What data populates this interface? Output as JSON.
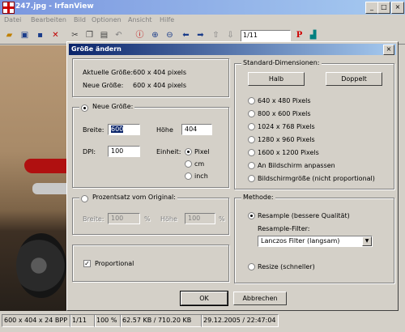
{
  "window": {
    "title": "247.jpg - IrfanView",
    "minimize": "_",
    "maximize": "□",
    "close": "×"
  },
  "menu": [
    "Datei",
    "Bearbeiten",
    "Bild",
    "Optionen",
    "Ansicht",
    "Hilfe"
  ],
  "toolbar": {
    "icons": [
      "open-folder-icon",
      "slideshow-icon",
      "save-icon",
      "delete-icon",
      "cut-icon",
      "copy-icon",
      "paste-icon",
      "undo-icon",
      "info-icon",
      "zoom-in-icon",
      "zoom-out-icon",
      "prev-arrow-icon",
      "next-arrow-icon",
      "first-page-icon",
      "last-page-icon"
    ],
    "page_box": "1/11",
    "print_letter": "P"
  },
  "dialog": {
    "title": "Größe ändern",
    "close": "×",
    "current_size_label": "Aktuelle Größe:",
    "current_size_value": "600  x  404  pixels",
    "new_size_label": "Neue Größe:",
    "new_size_value": "600  x  404  pixels",
    "new_size_group": "Neue Größe:",
    "width_label": "Breite:",
    "width_value": "600",
    "height_label": "Höhe",
    "height_value": "404",
    "dpi_label": "DPI:",
    "dpi_value": "100",
    "unit_label": "Einheit:",
    "unit_options": [
      "Pixel",
      "cm",
      "inch"
    ],
    "unit_selected": "Pixel",
    "percent_group": "Prozentsatz vom Original:",
    "pct_width_label": "Breite:",
    "pct_width_value": "100",
    "pct_height_label": "Höhe",
    "pct_height_value": "100",
    "percent_sign": "%",
    "proportional_label": "Proportional",
    "proportional_checked": true,
    "standard_group": "Standard-Dimensionen:",
    "half_button": "Halb",
    "double_button": "Doppelt",
    "standard_options": [
      "640 x 480 Pixels",
      "800 x 600 Pixels",
      "1024 x 768 Pixels",
      "1280 x 960 Pixels",
      "1600 x 1200 Pixels",
      "An Bildschirm anpassen",
      "Bildschirmgröße (nicht proportional)"
    ],
    "method_group": "Methode:",
    "resample_label": "Resample (bessere Qualität)",
    "resample_filter_label": "Resample-Filter:",
    "resample_filter_value": "Lanczos Filter (langsam)",
    "resize_label": "Resize (schneller)",
    "ok_button": "OK",
    "cancel_button": "Abbrechen"
  },
  "status": {
    "dimensions": "600 x 404 x 24 BPP",
    "page": "1/11",
    "zoom": "100 %",
    "filesize": "62.57 KB / 710.20 KB",
    "datetime": "29.12.2005 / 22:47:04"
  }
}
